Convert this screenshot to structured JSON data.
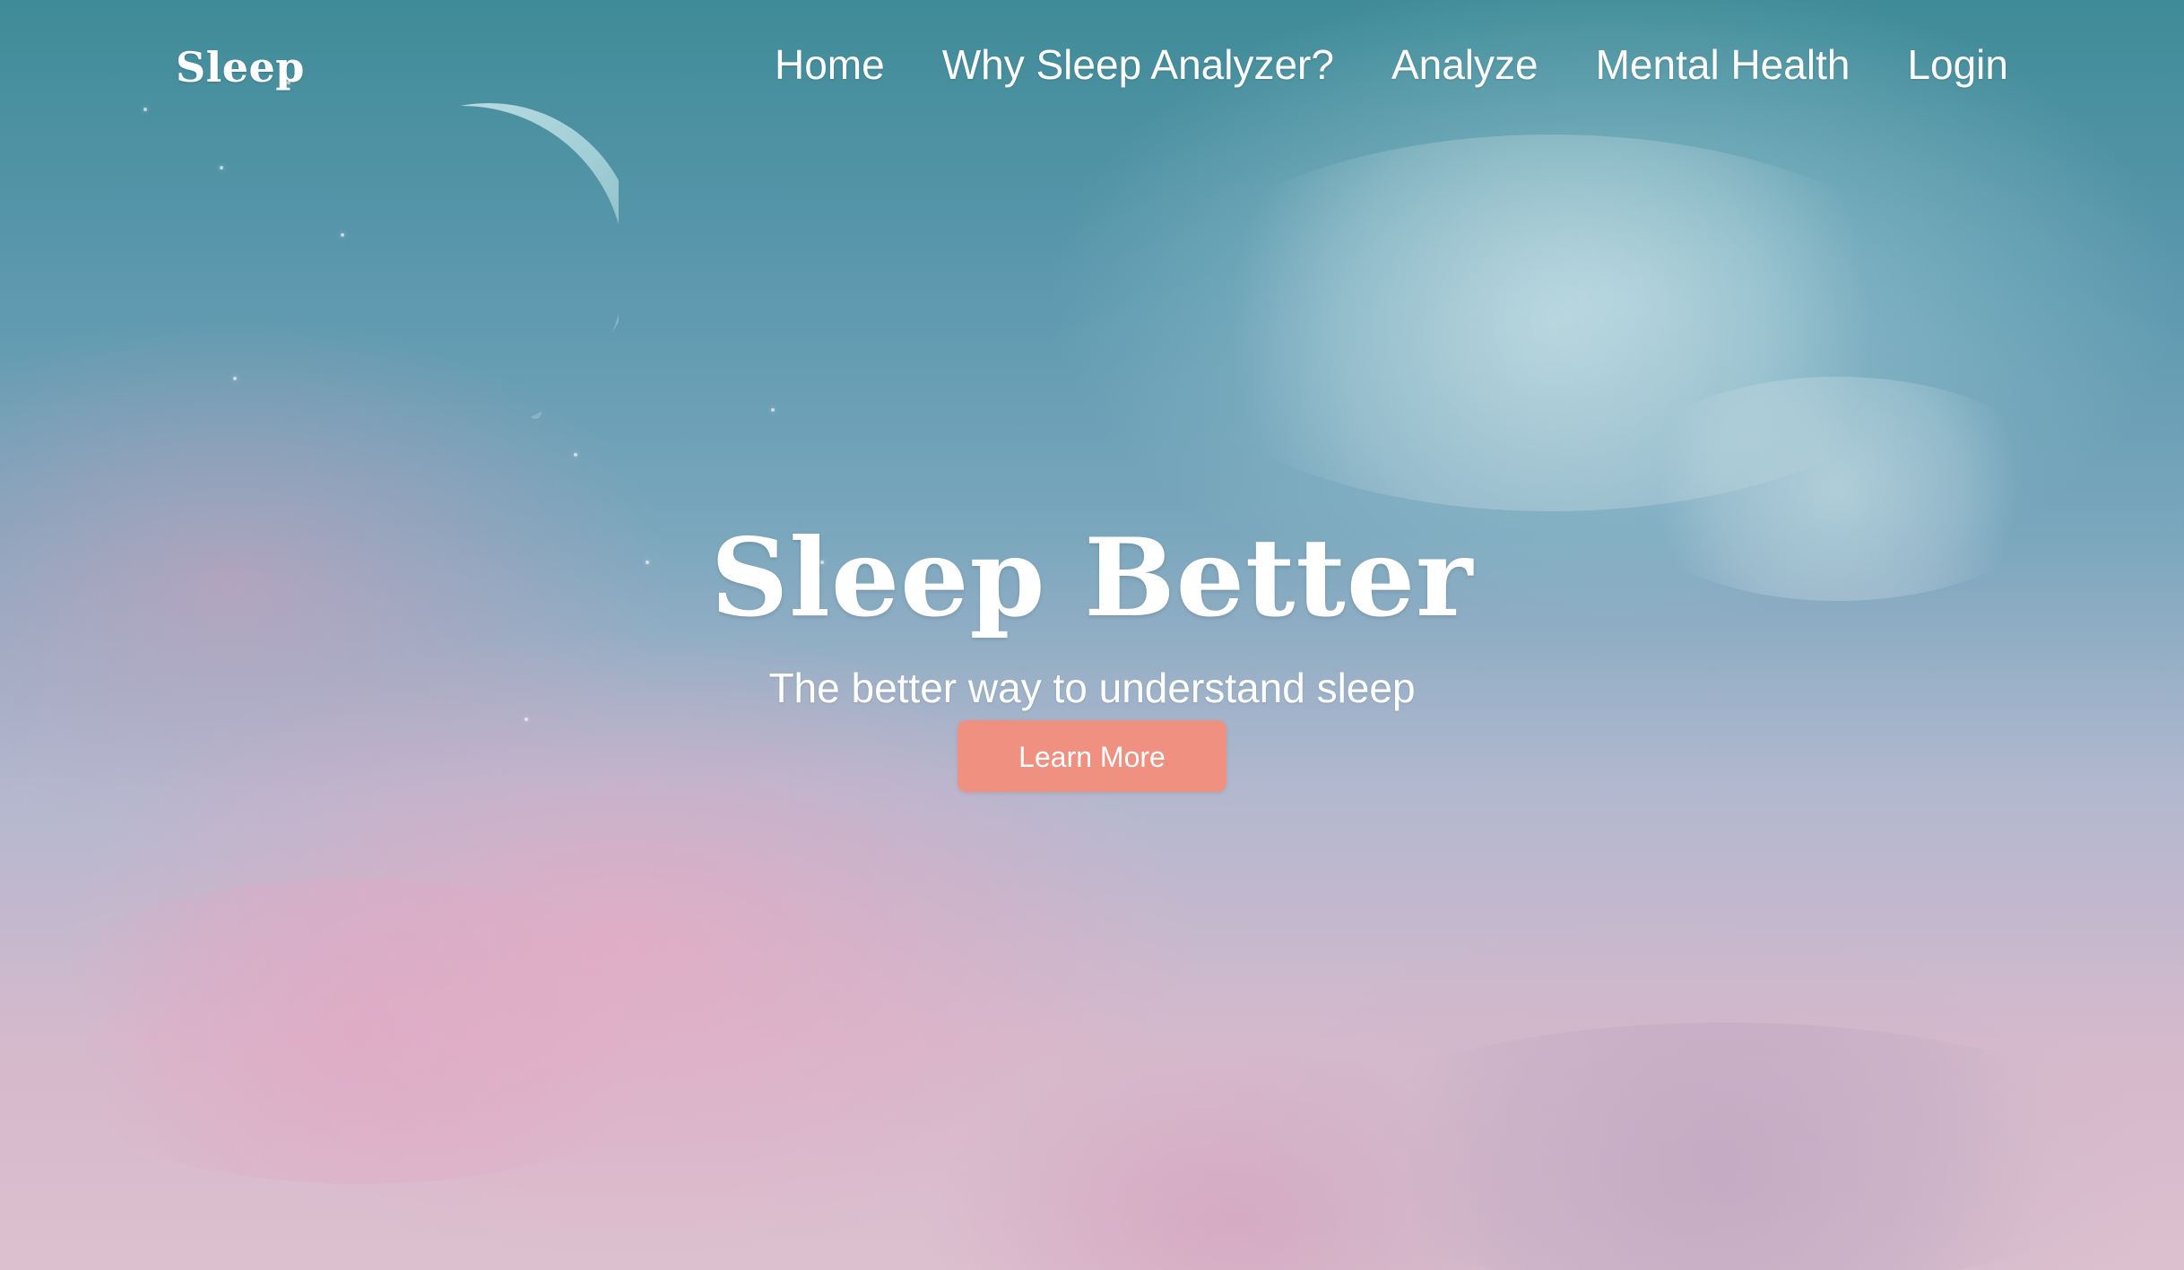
{
  "brand": {
    "name": "Sleep"
  },
  "nav": {
    "items": [
      {
        "label": "Home"
      },
      {
        "label": "Why Sleep Analyzer?"
      },
      {
        "label": "Analyze"
      },
      {
        "label": "Mental Health"
      },
      {
        "label": "Login"
      }
    ]
  },
  "hero": {
    "title": "Sleep Better",
    "subtitle": "The better way to understand sleep",
    "button_label": "Learn More"
  },
  "colors": {
    "button": "#f09080",
    "text": "#ffffff",
    "sky_top": "#3f8b98",
    "sky_bottom": "#dcc0cf"
  }
}
